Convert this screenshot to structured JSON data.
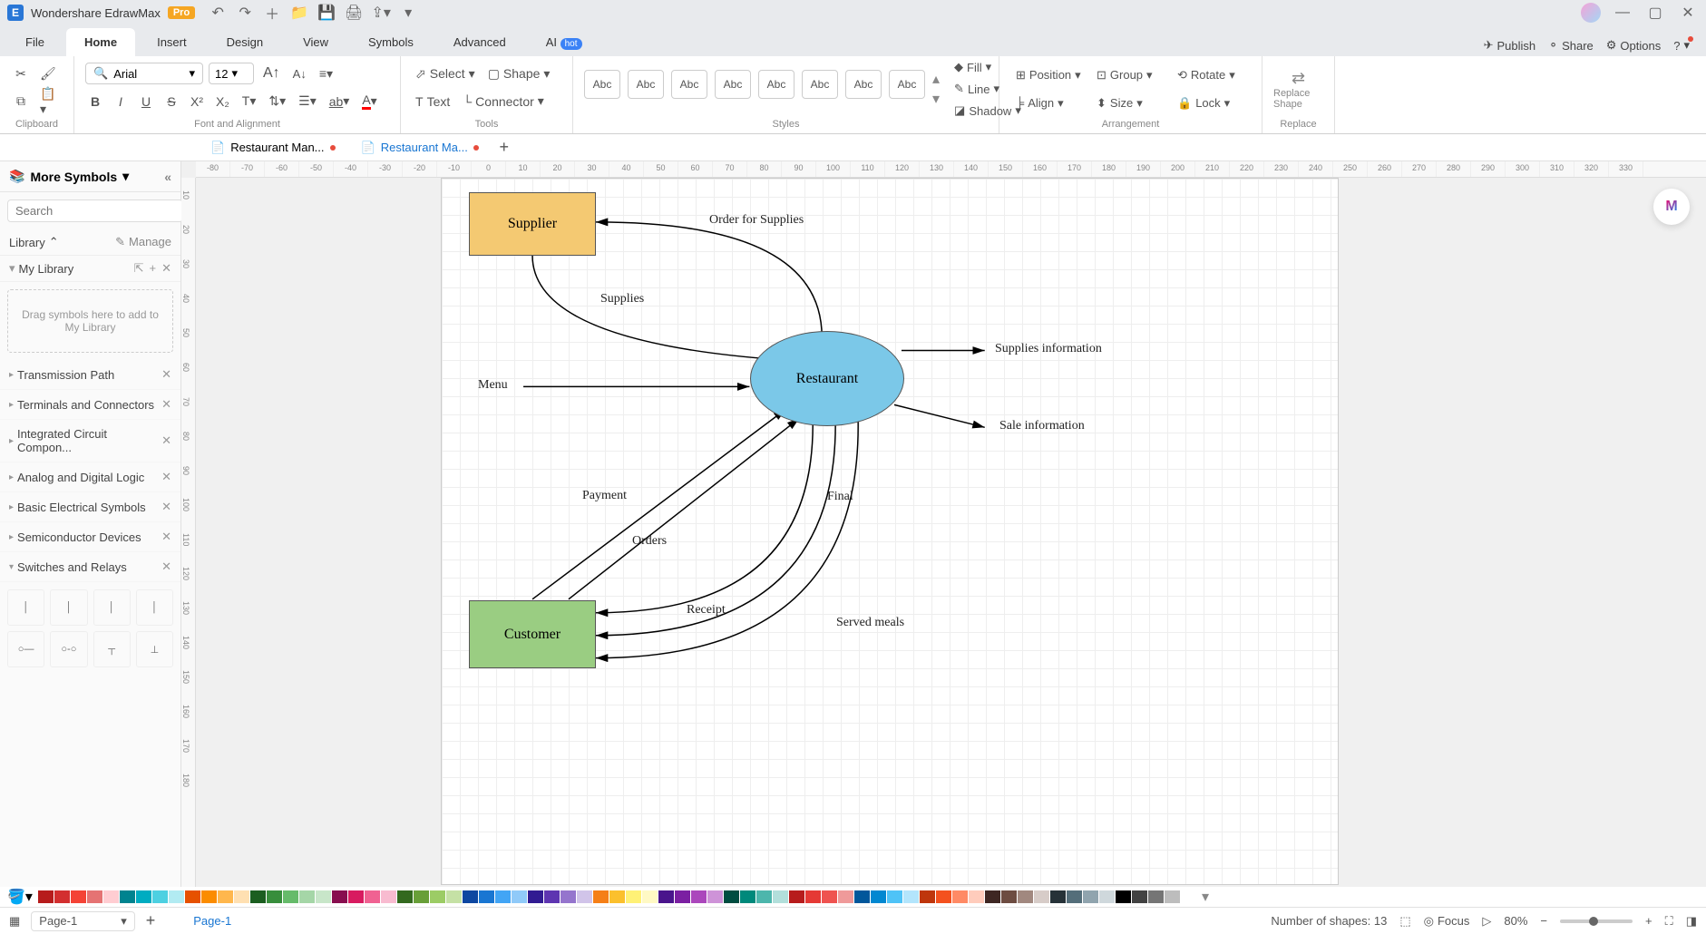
{
  "app": {
    "name": "Wondershare EdrawMax",
    "pro": "Pro"
  },
  "menu": {
    "file": "File",
    "home": "Home",
    "insert": "Insert",
    "design": "Design",
    "view": "View",
    "symbols": "Symbols",
    "advanced": "Advanced",
    "ai": "AI",
    "hot": "hot",
    "publish": "Publish",
    "share": "Share",
    "options": "Options"
  },
  "ribbon": {
    "clipboard": "Clipboard",
    "font_align": "Font and Alignment",
    "tools": "Tools",
    "styles": "Styles",
    "arrangement": "Arrangement",
    "replace": "Replace",
    "font": "Arial",
    "size": "12",
    "select": "Select",
    "shape": "Shape",
    "text": "Text",
    "connector": "Connector",
    "abc": "Abc",
    "fill": "Fill",
    "line": "Line",
    "shadow": "Shadow",
    "position": "Position",
    "group": "Group",
    "rotate": "Rotate",
    "align": "Align",
    "size_btn": "Size",
    "lock": "Lock",
    "replace_shape": "Replace Shape",
    "replace_btn": "Replace"
  },
  "docs": {
    "tab1": "Restaurant Man...",
    "tab2": "Restaurant Ma..."
  },
  "sidebar": {
    "title": "More Symbols",
    "search_ph": "Search",
    "search_btn": "Search",
    "library": "Library",
    "manage": "Manage",
    "mylib": "My Library",
    "drag": "Drag symbols here to add to My Library",
    "items": [
      "Transmission Path",
      "Terminals and Connectors",
      "Integrated Circuit Compon...",
      "Analog and Digital Logic",
      "Basic Electrical Symbols",
      "Semiconductor Devices",
      "Switches and Relays"
    ]
  },
  "diagram": {
    "supplier": "Supplier",
    "customer": "Customer",
    "restaurant": "Restaurant",
    "menu": "Menu",
    "order_supplies": "Order for Supplies",
    "supplies": "Supplies",
    "supplies_info": "Supplies information",
    "sale_info": "Sale information",
    "payment": "Payment",
    "orders": "Orders",
    "receipt": "Receipt",
    "served": "Served meals",
    "final": "Final"
  },
  "ruler_h": [
    "-80",
    "-70",
    "-60",
    "-50",
    "-40",
    "-30",
    "-20",
    "-10",
    "0",
    "10",
    "20",
    "30",
    "40",
    "50",
    "60",
    "70",
    "80",
    "90",
    "100",
    "110",
    "120",
    "130",
    "140",
    "150",
    "160",
    "170",
    "180",
    "190",
    "200",
    "210",
    "220",
    "230",
    "240",
    "250",
    "260",
    "270",
    "280",
    "290",
    "300",
    "310",
    "320",
    "330"
  ],
  "ruler_v": [
    "10",
    "20",
    "30",
    "40",
    "50",
    "60",
    "70",
    "80",
    "90",
    "100",
    "110",
    "120",
    "130",
    "140",
    "150",
    "160",
    "170",
    "180"
  ],
  "colors": [
    "#b71c1c",
    "#d32f2f",
    "#f44336",
    "#e57373",
    "#ffcdd2",
    "#00838f",
    "#00acc1",
    "#4dd0e1",
    "#b2ebf2",
    "#e65100",
    "#fb8c00",
    "#ffb74d",
    "#ffe0b2",
    "#1b5e20",
    "#388e3c",
    "#66bb6a",
    "#a5d6a7",
    "#c8e6c9",
    "#880e4f",
    "#d81b60",
    "#f06292",
    "#f8bbd0",
    "#33691e",
    "#689f38",
    "#9ccc65",
    "#c5e1a5",
    "#0d47a1",
    "#1976d2",
    "#42a5f5",
    "#90caf9",
    "#311b92",
    "#5e35b1",
    "#9575cd",
    "#d1c4e9",
    "#f57f17",
    "#fbc02d",
    "#fff176",
    "#fff9c4",
    "#4a148c",
    "#7b1fa2",
    "#ab47bc",
    "#ce93d8",
    "#004d40",
    "#00897b",
    "#4db6ac",
    "#b2dfdb",
    "#b71c1c",
    "#e53935",
    "#ef5350",
    "#ef9a9a",
    "#01579b",
    "#0288d1",
    "#4fc3f7",
    "#b3e5fc",
    "#bf360c",
    "#f4511e",
    "#ff8a65",
    "#ffccbc",
    "#3e2723",
    "#6d4c41",
    "#a1887f",
    "#d7ccc8",
    "#263238",
    "#546e7a",
    "#90a4ae",
    "#cfd8dc",
    "#000",
    "#424242",
    "#757575",
    "#bdbdbd",
    "#fff"
  ],
  "status": {
    "page_sel": "Page-1",
    "page": "Page-1",
    "shapes": "Number of shapes: 13",
    "focus": "Focus",
    "zoom": "80%"
  }
}
